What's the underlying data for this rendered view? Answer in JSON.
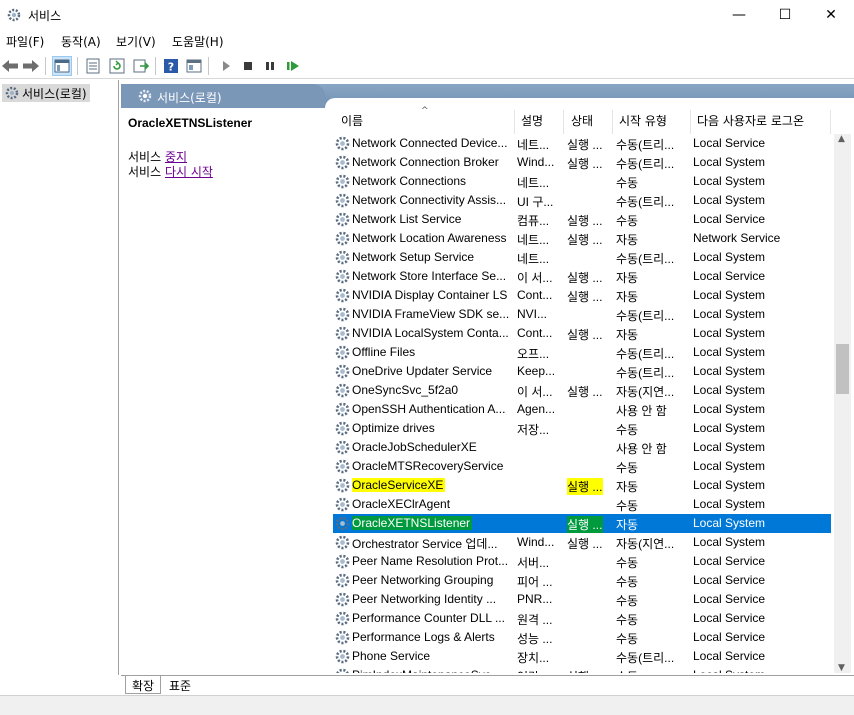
{
  "window": {
    "title": "서비스",
    "minimize_glyph": "—",
    "maximize_glyph": "☐",
    "close_glyph": "✕"
  },
  "menu": [
    "파일(F)",
    "동작(A)",
    "보기(V)",
    "도움말(H)"
  ],
  "toolbar": {
    "icons": [
      "back-icon",
      "forward-icon",
      "console-tree-icon",
      "properties-icon",
      "refresh-icon",
      "export-icon",
      "help-icon",
      "view-icon",
      "start-icon",
      "stop-icon",
      "pause-icon",
      "restart-icon"
    ]
  },
  "tree": {
    "item_label": "서비스(로컬)"
  },
  "pane": {
    "header_label": "서비스(로컬)",
    "selected_service": "OracleXETNSListener",
    "actions": [
      {
        "prefix": "서비스 ",
        "link": "중지"
      },
      {
        "prefix": "서비스 ",
        "link": "다시 시작"
      }
    ]
  },
  "columns": {
    "name": "이름",
    "description": "설명",
    "status": "상태",
    "startup": "시작 유형",
    "logon": "다음 사용자로 로그온"
  },
  "rows": [
    {
      "name": "Network Connected Device...",
      "desc": "네트...",
      "status": "실행 ...",
      "startup": "수동(트리...",
      "logon": "Local Service"
    },
    {
      "name": "Network Connection Broker",
      "desc": "Wind...",
      "status": "실행 ...",
      "startup": "수동(트리...",
      "logon": "Local System"
    },
    {
      "name": "Network Connections",
      "desc": "네트...",
      "status": "",
      "startup": "수동",
      "logon": "Local System"
    },
    {
      "name": "Network Connectivity Assis...",
      "desc": "UI 구...",
      "status": "",
      "startup": "수동(트리...",
      "logon": "Local System"
    },
    {
      "name": "Network List Service",
      "desc": "컴퓨...",
      "status": "실행 ...",
      "startup": "수동",
      "logon": "Local Service"
    },
    {
      "name": "Network Location Awareness",
      "desc": "네트...",
      "status": "실행 ...",
      "startup": "자동",
      "logon": "Network Service"
    },
    {
      "name": "Network Setup Service",
      "desc": "네트...",
      "status": "",
      "startup": "수동(트리...",
      "logon": "Local System"
    },
    {
      "name": "Network Store Interface Se...",
      "desc": "이 서...",
      "status": "실행 ...",
      "startup": "자동",
      "logon": "Local Service"
    },
    {
      "name": "NVIDIA Display Container LS",
      "desc": "Cont...",
      "status": "실행 ...",
      "startup": "자동",
      "logon": "Local System"
    },
    {
      "name": "NVIDIA FrameView SDK se...",
      "desc": "NVI...",
      "status": "",
      "startup": "수동(트리...",
      "logon": "Local System"
    },
    {
      "name": "NVIDIA LocalSystem Conta...",
      "desc": "Cont...",
      "status": "실행 ...",
      "startup": "자동",
      "logon": "Local System"
    },
    {
      "name": "Offline Files",
      "desc": "오프...",
      "status": "",
      "startup": "수동(트리...",
      "logon": "Local System"
    },
    {
      "name": "OneDrive Updater Service",
      "desc": "Keep...",
      "status": "",
      "startup": "수동(트리...",
      "logon": "Local System"
    },
    {
      "name": "OneSyncSvc_5f2a0",
      "desc": "이 서...",
      "status": "실행 ...",
      "startup": "자동(지연...",
      "logon": "Local System"
    },
    {
      "name": "OpenSSH Authentication A...",
      "desc": "Agen...",
      "status": "",
      "startup": "사용 안 함",
      "logon": "Local System"
    },
    {
      "name": "Optimize drives",
      "desc": "저장...",
      "status": "",
      "startup": "수동",
      "logon": "Local System"
    },
    {
      "name": "OracleJobSchedulerXE",
      "desc": "",
      "status": "",
      "startup": "사용 안 함",
      "logon": "Local System"
    },
    {
      "name": "OracleMTSRecoveryService",
      "desc": "",
      "status": "",
      "startup": "수동",
      "logon": "Local System"
    },
    {
      "name": "OracleServiceXE",
      "desc": "",
      "status": "실행 ...",
      "startup": "자동",
      "logon": "Local System",
      "highlight": "yellow"
    },
    {
      "name": "OracleXEClrAgent",
      "desc": "",
      "status": "",
      "startup": "수동",
      "logon": "Local System"
    },
    {
      "name": "OracleXETNSListener",
      "desc": "",
      "status": "실행 ...",
      "startup": "자동",
      "logon": "Local System",
      "highlight": "green",
      "selected": true
    },
    {
      "name": "Orchestrator Service 업데...",
      "desc": "Wind...",
      "status": "실행 ...",
      "startup": "자동(지연...",
      "logon": "Local System"
    },
    {
      "name": "Peer Name Resolution Prot...",
      "desc": "서버...",
      "status": "",
      "startup": "수동",
      "logon": "Local Service"
    },
    {
      "name": "Peer Networking Grouping",
      "desc": "피어 ...",
      "status": "",
      "startup": "수동",
      "logon": "Local Service"
    },
    {
      "name": "Peer Networking Identity ...",
      "desc": "PNR...",
      "status": "",
      "startup": "수동",
      "logon": "Local Service"
    },
    {
      "name": "Performance Counter DLL ...",
      "desc": "원격 ...",
      "status": "",
      "startup": "수동",
      "logon": "Local Service"
    },
    {
      "name": "Performance Logs & Alerts",
      "desc": "성능 ...",
      "status": "",
      "startup": "수동",
      "logon": "Local Service"
    },
    {
      "name": "Phone Service",
      "desc": "장치...",
      "status": "",
      "startup": "수동(트리...",
      "logon": "Local Service"
    },
    {
      "name": "PimIndexMaintenanceSvc...",
      "desc": "연락...",
      "status": "실행 ...",
      "startup": "수동",
      "logon": "Local System"
    }
  ],
  "tabs": [
    "확장",
    "표준"
  ],
  "colors": {
    "selection": "#0078d7",
    "highlight_yellow": "#ffff00",
    "highlight_green": "#009a3e",
    "header_blue": "#7b97b8",
    "link_purple": "#6e0090"
  }
}
